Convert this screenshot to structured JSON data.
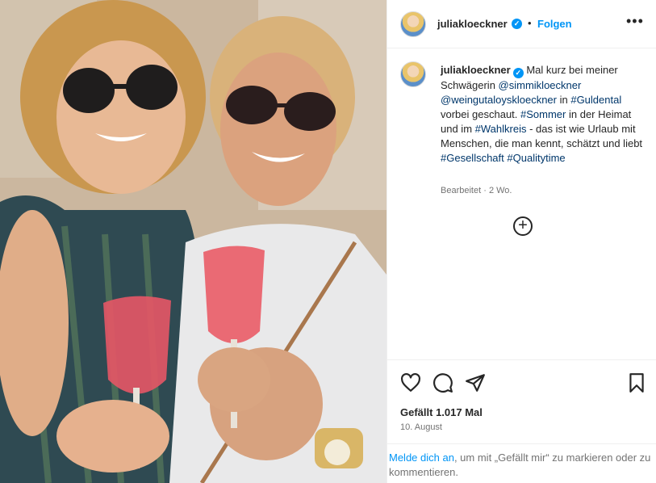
{
  "photo": {
    "alt_icon": "photo-two-women-with-drinks"
  },
  "header": {
    "username": "juliakloeckner",
    "verified_icon": "verified-badge-icon",
    "separator": "•",
    "follow_label": "Folgen",
    "more_icon": "more-options-icon",
    "more_glyph": "•••"
  },
  "caption": {
    "username": "juliakloeckner",
    "text_1": " Mal kurz bei meiner Schwägerin ",
    "mention_1": "@simmikloeckner",
    "text_2": " ",
    "mention_2": "@weingutaloyskloeckner",
    "text_3": " in ",
    "tag_1": "#Guldental",
    "text_4": " vorbei geschaut. ",
    "tag_2": "#Sommer",
    "text_5": " in der Heimat und im ",
    "tag_3": "#Wahlkreis",
    "text_6": " - das ist wie Urlaub mit Menschen, die man kennt, schätzt und liebt ",
    "tag_4": "#Gesellschaft",
    "text_7": " ",
    "tag_5": "#Qualitytime",
    "edited": "Bearbeitet",
    "meta_sep": " · ",
    "age": "2 Wo."
  },
  "load_more": {
    "glyph": "+"
  },
  "actions": {
    "like_icon": "heart-icon",
    "comment_icon": "comment-icon",
    "share_icon": "share-icon",
    "save_icon": "bookmark-icon",
    "likes_text": "Gefällt 1.017 Mal",
    "date": "10. August"
  },
  "login_prompt": {
    "link": "Melde dich an",
    "rest": ", um mit „Gefällt mir“ zu markieren oder zu kommentieren."
  },
  "colors": {
    "link_blue": "#0095f6",
    "tag_blue": "#00376b",
    "muted": "#737373"
  }
}
